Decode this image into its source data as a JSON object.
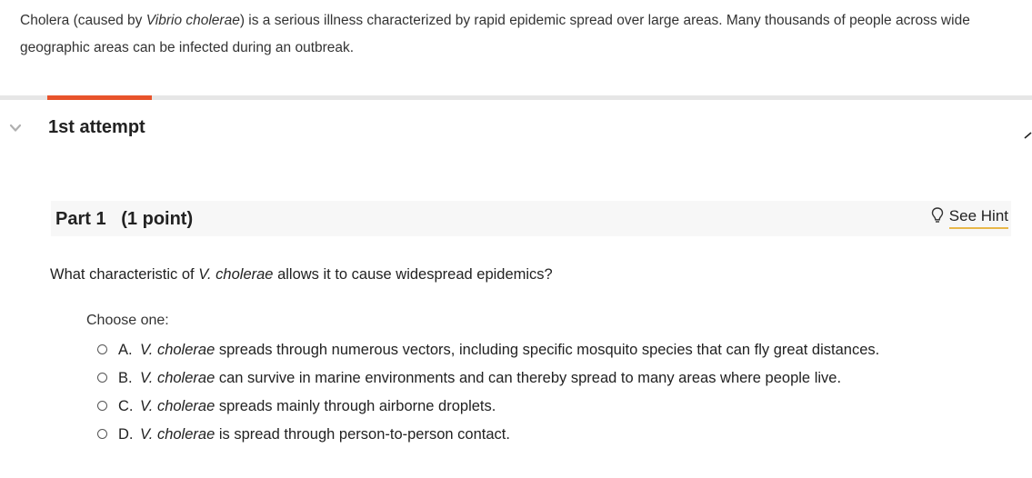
{
  "intro": {
    "before": "Cholera (caused by ",
    "organism": "Vibrio cholerae",
    "after": ") is a serious illness characterized by rapid epidemic spread over large areas. Many thousands of people across wide geographic areas can be infected during an outbreak."
  },
  "attempt": {
    "title": "1st attempt"
  },
  "part": {
    "title": "Part 1   (1 point)",
    "hint_label": "See Hint"
  },
  "question": {
    "before": "What characteristic of ",
    "organism": "V. cholerae",
    "after": " allows it to cause widespread epidemics?"
  },
  "choose_label": "Choose one:",
  "options": [
    {
      "letter": "A.",
      "organism": "V. cholerae",
      "text": " spreads through numerous vectors, including specific mosquito species that can fly great distances."
    },
    {
      "letter": "B.",
      "organism": "V. cholerae",
      "text": " can survive in marine environments and can thereby spread to many areas where people live."
    },
    {
      "letter": "C.",
      "organism": "V. cholerae",
      "text": " spreads mainly through airborne droplets."
    },
    {
      "letter": "D.",
      "organism": "V. cholerae",
      "text": " is spread through person-to-person contact."
    }
  ],
  "colors": {
    "accent": "#e8532b",
    "hint_underline": "#e8b74a",
    "header_bg": "#f7f7f7",
    "divider": "#e6e6e6"
  },
  "icons": {
    "collapse": "chevron-down-icon",
    "hint": "lightbulb-icon"
  }
}
